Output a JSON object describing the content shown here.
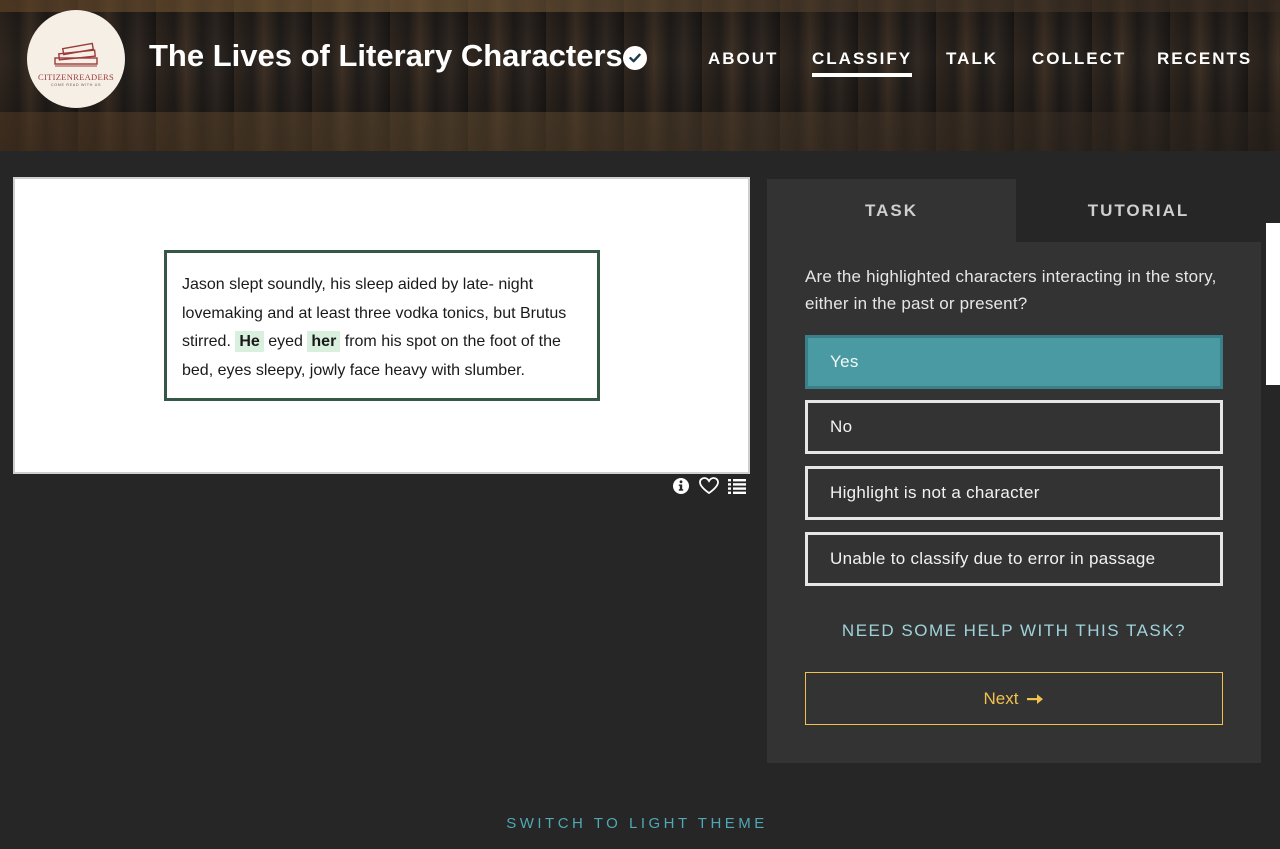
{
  "header": {
    "logo": {
      "name": "CitizenReaders",
      "tagline": "Come Read With Us"
    },
    "project_title": "The Lives of Literary Characters",
    "nav": [
      {
        "label": "ABOUT",
        "active": false
      },
      {
        "label": "CLASSIFY",
        "active": true
      },
      {
        "label": "TALK",
        "active": false
      },
      {
        "label": "COLLECT",
        "active": false
      },
      {
        "label": "RECENTS",
        "active": false
      }
    ]
  },
  "subject": {
    "passage": {
      "part1": "Jason slept soundly, his sleep aided by late- night lovemaking and at least three vodka tonics, but Brutus stirred. ",
      "highlight1": "He",
      "part2": " eyed ",
      "highlight2": "her",
      "part3": " from his spot on the foot of the bed, eyes sleepy, jowly face heavy with slumber."
    },
    "tools": [
      "info-icon",
      "heart-icon",
      "list-icon"
    ]
  },
  "task_panel": {
    "tabs": [
      {
        "label": "TASK",
        "active": true
      },
      {
        "label": "TUTORIAL",
        "active": false
      }
    ],
    "question": "Are the highlighted characters interacting in the story, either in the past or present?",
    "answers": [
      {
        "label": "Yes",
        "selected": true
      },
      {
        "label": "No",
        "selected": false
      },
      {
        "label": "Highlight is not a character",
        "selected": false
      },
      {
        "label": "Unable to classify due to error in passage",
        "selected": false
      }
    ],
    "help_link": "NEED SOME HELP WITH THIS TASK?",
    "next_label": "Next"
  },
  "footer": {
    "theme_toggle": "SWITCH TO LIGHT THEME"
  },
  "colors": {
    "selected_answer": "#4a9aa3",
    "next_button": "#f0c14d",
    "link_teal": "#9fd3db",
    "passage_border": "#345845",
    "highlight": "#d9f0df"
  }
}
